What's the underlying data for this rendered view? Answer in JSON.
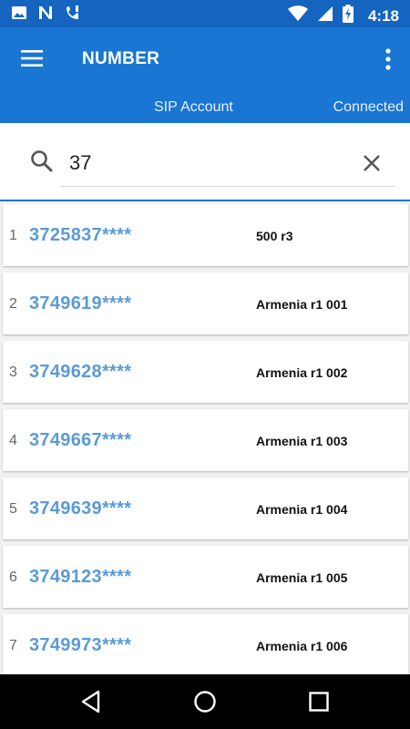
{
  "status_bar": {
    "time": "4:18",
    "left_icons": [
      "image-icon",
      "n-notification-icon",
      "phone-alert-icon"
    ],
    "right_icons": [
      "wifi-icon",
      "signal-icon",
      "battery-charging-icon"
    ]
  },
  "app_bar": {
    "title": "NUMBER",
    "sip_account_label": "SIP Account",
    "connection_status": "Connected",
    "background": "#1976d2",
    "status_bar_background": "#1565c0"
  },
  "search": {
    "value": "37",
    "icon": "search-icon",
    "clear_icon": "close-icon"
  },
  "results": [
    {
      "index": "1",
      "number": "3725837****",
      "name": "500 r3"
    },
    {
      "index": "2",
      "number": "3749619****",
      "name": "Armenia r1 001"
    },
    {
      "index": "3",
      "number": "3749628****",
      "name": "Armenia r1 002"
    },
    {
      "index": "4",
      "number": "3749667****",
      "name": "Armenia r1 003"
    },
    {
      "index": "5",
      "number": "3749639****",
      "name": "Armenia r1 004"
    },
    {
      "index": "6",
      "number": "3749123****",
      "name": "Armenia r1 005"
    },
    {
      "index": "7",
      "number": "3749973****",
      "name": "Armenia r1 006"
    }
  ],
  "colors": {
    "number_text": "#5b9bd5",
    "accent": "#1976d2"
  },
  "nav_bar": {
    "buttons": [
      "back-icon",
      "home-icon",
      "recents-icon"
    ]
  }
}
